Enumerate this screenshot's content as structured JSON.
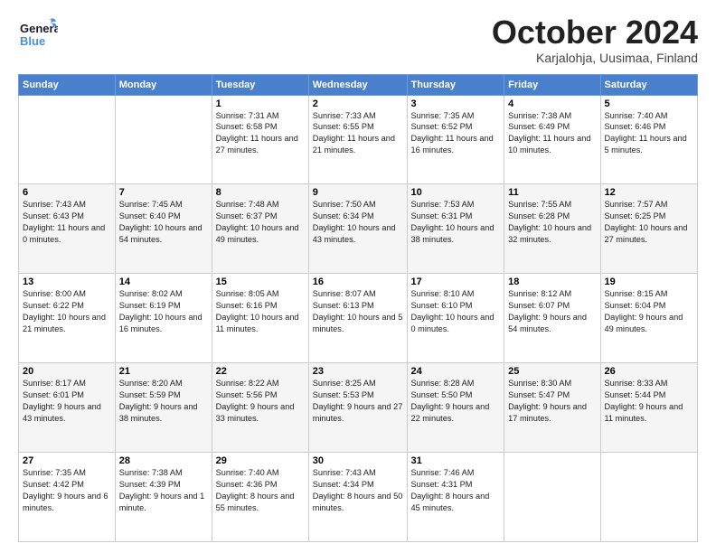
{
  "logo": {
    "line1": "General",
    "line2": "Blue"
  },
  "title": "October 2024",
  "subtitle": "Karjalohja, Uusimaa, Finland",
  "days_of_week": [
    "Sunday",
    "Monday",
    "Tuesday",
    "Wednesday",
    "Thursday",
    "Friday",
    "Saturday"
  ],
  "weeks": [
    [
      null,
      null,
      {
        "day": 1,
        "sunrise": "Sunrise: 7:31 AM",
        "sunset": "Sunset: 6:58 PM",
        "daylight": "Daylight: 11 hours and 27 minutes."
      },
      {
        "day": 2,
        "sunrise": "Sunrise: 7:33 AM",
        "sunset": "Sunset: 6:55 PM",
        "daylight": "Daylight: 11 hours and 21 minutes."
      },
      {
        "day": 3,
        "sunrise": "Sunrise: 7:35 AM",
        "sunset": "Sunset: 6:52 PM",
        "daylight": "Daylight: 11 hours and 16 minutes."
      },
      {
        "day": 4,
        "sunrise": "Sunrise: 7:38 AM",
        "sunset": "Sunset: 6:49 PM",
        "daylight": "Daylight: 11 hours and 10 minutes."
      },
      {
        "day": 5,
        "sunrise": "Sunrise: 7:40 AM",
        "sunset": "Sunset: 6:46 PM",
        "daylight": "Daylight: 11 hours and 5 minutes."
      }
    ],
    [
      {
        "day": 6,
        "sunrise": "Sunrise: 7:43 AM",
        "sunset": "Sunset: 6:43 PM",
        "daylight": "Daylight: 11 hours and 0 minutes."
      },
      {
        "day": 7,
        "sunrise": "Sunrise: 7:45 AM",
        "sunset": "Sunset: 6:40 PM",
        "daylight": "Daylight: 10 hours and 54 minutes."
      },
      {
        "day": 8,
        "sunrise": "Sunrise: 7:48 AM",
        "sunset": "Sunset: 6:37 PM",
        "daylight": "Daylight: 10 hours and 49 minutes."
      },
      {
        "day": 9,
        "sunrise": "Sunrise: 7:50 AM",
        "sunset": "Sunset: 6:34 PM",
        "daylight": "Daylight: 10 hours and 43 minutes."
      },
      {
        "day": 10,
        "sunrise": "Sunrise: 7:53 AM",
        "sunset": "Sunset: 6:31 PM",
        "daylight": "Daylight: 10 hours and 38 minutes."
      },
      {
        "day": 11,
        "sunrise": "Sunrise: 7:55 AM",
        "sunset": "Sunset: 6:28 PM",
        "daylight": "Daylight: 10 hours and 32 minutes."
      },
      {
        "day": 12,
        "sunrise": "Sunrise: 7:57 AM",
        "sunset": "Sunset: 6:25 PM",
        "daylight": "Daylight: 10 hours and 27 minutes."
      }
    ],
    [
      {
        "day": 13,
        "sunrise": "Sunrise: 8:00 AM",
        "sunset": "Sunset: 6:22 PM",
        "daylight": "Daylight: 10 hours and 21 minutes."
      },
      {
        "day": 14,
        "sunrise": "Sunrise: 8:02 AM",
        "sunset": "Sunset: 6:19 PM",
        "daylight": "Daylight: 10 hours and 16 minutes."
      },
      {
        "day": 15,
        "sunrise": "Sunrise: 8:05 AM",
        "sunset": "Sunset: 6:16 PM",
        "daylight": "Daylight: 10 hours and 11 minutes."
      },
      {
        "day": 16,
        "sunrise": "Sunrise: 8:07 AM",
        "sunset": "Sunset: 6:13 PM",
        "daylight": "Daylight: 10 hours and 5 minutes."
      },
      {
        "day": 17,
        "sunrise": "Sunrise: 8:10 AM",
        "sunset": "Sunset: 6:10 PM",
        "daylight": "Daylight: 10 hours and 0 minutes."
      },
      {
        "day": 18,
        "sunrise": "Sunrise: 8:12 AM",
        "sunset": "Sunset: 6:07 PM",
        "daylight": "Daylight: 9 hours and 54 minutes."
      },
      {
        "day": 19,
        "sunrise": "Sunrise: 8:15 AM",
        "sunset": "Sunset: 6:04 PM",
        "daylight": "Daylight: 9 hours and 49 minutes."
      }
    ],
    [
      {
        "day": 20,
        "sunrise": "Sunrise: 8:17 AM",
        "sunset": "Sunset: 6:01 PM",
        "daylight": "Daylight: 9 hours and 43 minutes."
      },
      {
        "day": 21,
        "sunrise": "Sunrise: 8:20 AM",
        "sunset": "Sunset: 5:59 PM",
        "daylight": "Daylight: 9 hours and 38 minutes."
      },
      {
        "day": 22,
        "sunrise": "Sunrise: 8:22 AM",
        "sunset": "Sunset: 5:56 PM",
        "daylight": "Daylight: 9 hours and 33 minutes."
      },
      {
        "day": 23,
        "sunrise": "Sunrise: 8:25 AM",
        "sunset": "Sunset: 5:53 PM",
        "daylight": "Daylight: 9 hours and 27 minutes."
      },
      {
        "day": 24,
        "sunrise": "Sunrise: 8:28 AM",
        "sunset": "Sunset: 5:50 PM",
        "daylight": "Daylight: 9 hours and 22 minutes."
      },
      {
        "day": 25,
        "sunrise": "Sunrise: 8:30 AM",
        "sunset": "Sunset: 5:47 PM",
        "daylight": "Daylight: 9 hours and 17 minutes."
      },
      {
        "day": 26,
        "sunrise": "Sunrise: 8:33 AM",
        "sunset": "Sunset: 5:44 PM",
        "daylight": "Daylight: 9 hours and 11 minutes."
      }
    ],
    [
      {
        "day": 27,
        "sunrise": "Sunrise: 7:35 AM",
        "sunset": "Sunset: 4:42 PM",
        "daylight": "Daylight: 9 hours and 6 minutes."
      },
      {
        "day": 28,
        "sunrise": "Sunrise: 7:38 AM",
        "sunset": "Sunset: 4:39 PM",
        "daylight": "Daylight: 9 hours and 1 minute."
      },
      {
        "day": 29,
        "sunrise": "Sunrise: 7:40 AM",
        "sunset": "Sunset: 4:36 PM",
        "daylight": "Daylight: 8 hours and 55 minutes."
      },
      {
        "day": 30,
        "sunrise": "Sunrise: 7:43 AM",
        "sunset": "Sunset: 4:34 PM",
        "daylight": "Daylight: 8 hours and 50 minutes."
      },
      {
        "day": 31,
        "sunrise": "Sunrise: 7:46 AM",
        "sunset": "Sunset: 4:31 PM",
        "daylight": "Daylight: 8 hours and 45 minutes."
      },
      null,
      null
    ]
  ]
}
